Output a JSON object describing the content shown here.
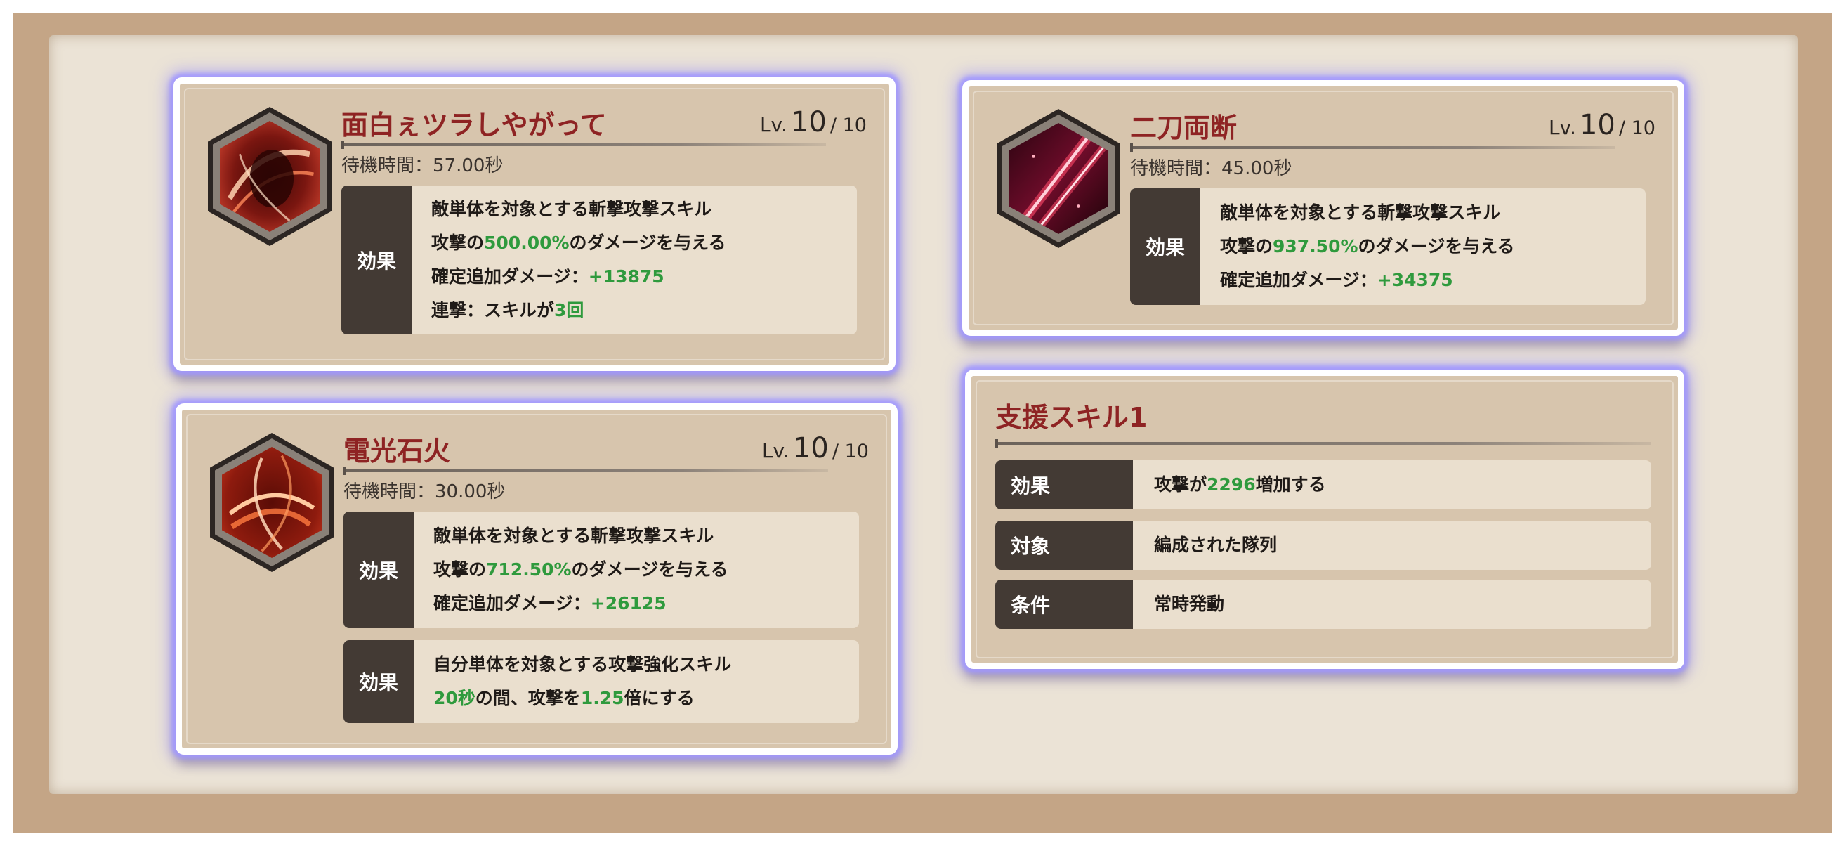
{
  "skills": [
    {
      "title": "面白ぇツラしやがって",
      "lv_label": "Lv.",
      "lv_value": "10",
      "lv_max": "/ 10",
      "wait": "待機時間：57.00秒",
      "icon": "fist-slash-icon",
      "effects": [
        {
          "tag": "効果",
          "lines": [
            [
              {
                "t": "敵単体を対象とする斬撃攻撃スキル"
              }
            ],
            [
              {
                "t": "攻撃の"
              },
              {
                "t": "500.00%",
                "g": true
              },
              {
                "t": "のダメージを与える"
              }
            ],
            [
              {
                "t": "確定追加ダメージ："
              },
              {
                "t": "+13875",
                "g": true
              }
            ],
            [
              {
                "t": "連撃：スキルが"
              },
              {
                "t": "3回",
                "g": true
              }
            ]
          ]
        }
      ]
    },
    {
      "title": "二刀両断",
      "lv_label": "Lv.",
      "lv_value": "10",
      "lv_max": "/ 10",
      "wait": "待機時間：45.00秒",
      "icon": "twin-slash-icon",
      "effects": [
        {
          "tag": "効果",
          "lines": [
            [
              {
                "t": "敵単体を対象とする斬撃攻撃スキル"
              }
            ],
            [
              {
                "t": "攻撃の"
              },
              {
                "t": "937.50%",
                "g": true
              },
              {
                "t": "のダメージを与える"
              }
            ],
            [
              {
                "t": "確定追加ダメージ："
              },
              {
                "t": "+34375",
                "g": true
              }
            ]
          ]
        }
      ]
    },
    {
      "title": "電光石火",
      "lv_label": "Lv.",
      "lv_value": "10",
      "lv_max": "/ 10",
      "wait": "待機時間：30.00秒",
      "icon": "swirl-slash-icon",
      "effects": [
        {
          "tag": "効果",
          "lines": [
            [
              {
                "t": "敵単体を対象とする斬撃攻撃スキル"
              }
            ],
            [
              {
                "t": "攻撃の"
              },
              {
                "t": "712.50%",
                "g": true
              },
              {
                "t": "のダメージを与える"
              }
            ],
            [
              {
                "t": "確定追加ダメージ："
              },
              {
                "t": "+26125",
                "g": true
              }
            ]
          ]
        },
        {
          "tag": "効果",
          "lines": [
            [
              {
                "t": "自分単体を対象とする攻撃強化スキル"
              }
            ],
            [
              {
                "t": "20秒",
                "g": true
              },
              {
                "t": "の間、攻撃を"
              },
              {
                "t": "1.25",
                "g": true
              },
              {
                "t": "倍にする"
              }
            ]
          ]
        }
      ]
    }
  ],
  "support": {
    "title": "支援スキル1",
    "rows": [
      {
        "tag": "効果",
        "value": [
          {
            "t": "攻撃が"
          },
          {
            "t": "2296",
            "g": true
          },
          {
            "t": "増加する"
          }
        ]
      },
      {
        "tag": "対象",
        "value": [
          {
            "t": "編成された隊列"
          }
        ]
      },
      {
        "tag": "条件",
        "value": [
          {
            "t": "常時発動"
          }
        ]
      }
    ]
  },
  "colors": {
    "title": "#8e2323",
    "highlight": "#2f9a3d",
    "tag_bg": "#433a34",
    "glow": "#a09aff"
  }
}
